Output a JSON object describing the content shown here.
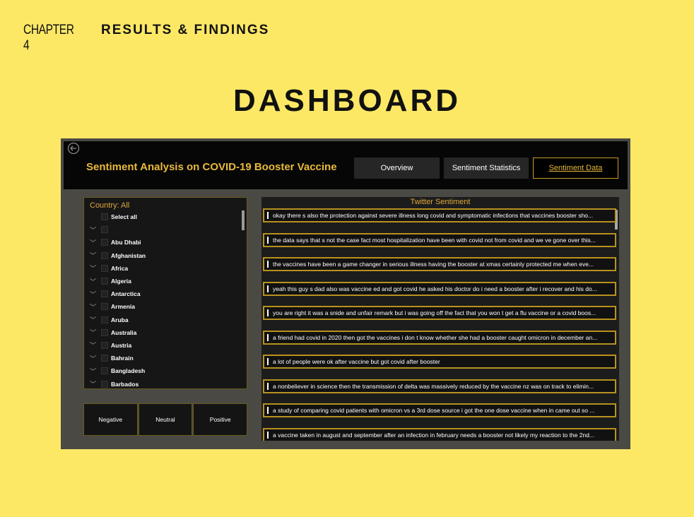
{
  "chapter": {
    "number": "CHAPTER 4",
    "title": "RESULTS & FINDINGS"
  },
  "heading": "DASHBOARD",
  "app": {
    "title": "Sentiment Analysis on COVID-19 Booster Vaccine",
    "nav": [
      {
        "label": "Overview"
      },
      {
        "label": "Sentiment Statistics"
      },
      {
        "label": "Sentiment Data",
        "active": true
      }
    ]
  },
  "slicer": {
    "header": "Country: All",
    "items": [
      "Select all",
      "",
      "Abu Dhabi",
      "Afghanistan",
      "Africa",
      "Algeria",
      "Antarctica",
      "Armenia",
      "Aruba",
      "Australia",
      "Austria",
      "Bahrain",
      "Bangladesh",
      "Barbados"
    ]
  },
  "sentiment_buttons": [
    "Negative",
    "Neutral",
    "Positive"
  ],
  "tweets": {
    "title": "Twitter Sentiment",
    "items": [
      "okay there s also the protection against severe illness long covid and symptomatic infections that vaccines booster sho...",
      "the data says that s not the case fact most hospitalization have been with covid not from covid and we ve gone over this...",
      "the vaccines have been a game changer in serious illness having the booster at xmas certainly protected me when eve...",
      "yeah this guy s dad also was vaccine ed and got covid he asked his doctor do i need a booster after i recover and his do...",
      "you are right it was a snide and unfair remark but i was going off the fact that you won t get a flu vaccine or a covid boos...",
      "a friend had covid in 2020 then got the vaccines i don t know whether she had a booster caught omicron in december an...",
      "a lot of people were ok after vaccine but got covid after booster",
      "a nonbeliever in science then the transmission of delta was massively reduced by the vaccine nz was on track to elimin...",
      "a study of comparing covid patients with omicron vs a 3rd dose source i got the one dose vaccine when in came out so ...",
      "a vaccine taken in august and september after an infection in february needs a booster not likely my reaction to the 2nd..."
    ]
  },
  "colors": {
    "background": "#fde866",
    "accent": "#e8b93a",
    "panel": "#4a4944"
  }
}
